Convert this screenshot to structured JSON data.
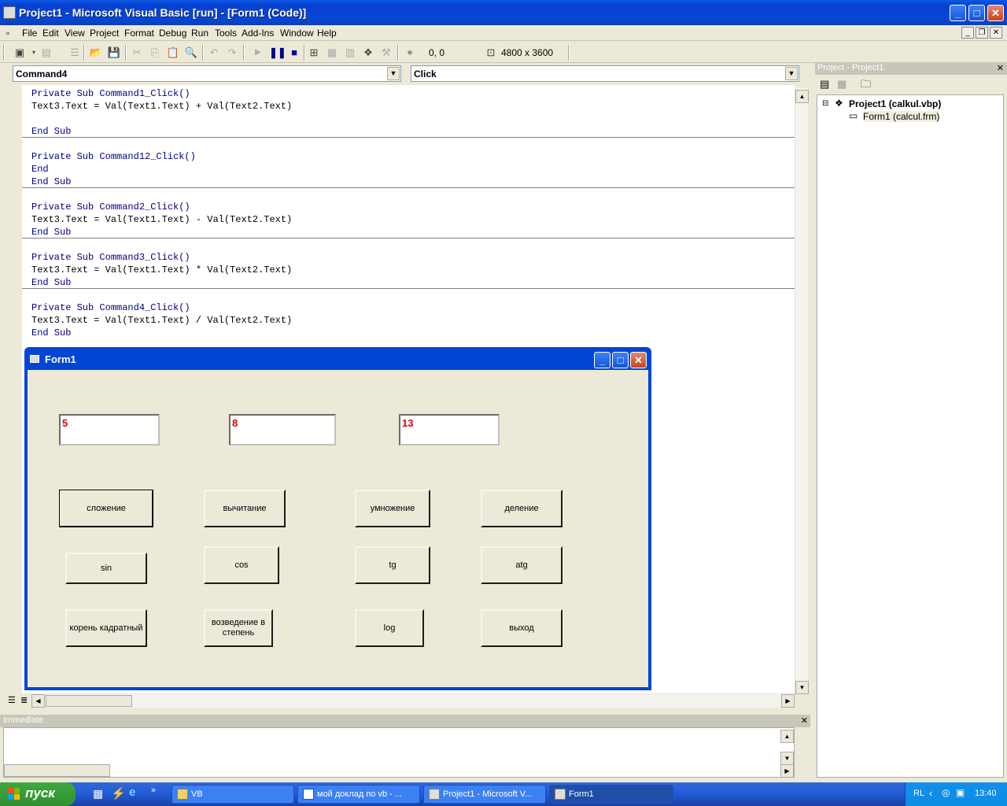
{
  "window": {
    "title": "Project1 - Microsoft Visual Basic [run] - [Form1 (Code)]"
  },
  "menu": [
    "File",
    "Edit",
    "View",
    "Project",
    "Format",
    "Debug",
    "Run",
    "Tools",
    "Add-Ins",
    "Window",
    "Help"
  ],
  "toolbar": {
    "position": "0, 0",
    "size": "4800 x 3600"
  },
  "code_window": {
    "object_combo": "Command4",
    "procedure_combo": "Click",
    "procedures": [
      {
        "header": "Private Sub Command1_Click()",
        "body": "Text3.Text = Val(Text1.Text) + Val(Text2.Text)\n",
        "end": "End Sub"
      },
      {
        "header": "Private Sub Command12_Click()",
        "body": "End",
        "end": "End Sub"
      },
      {
        "header": "Private Sub Command2_Click()",
        "body": "Text3.Text = Val(Text1.Text) - Val(Text2.Text)",
        "end": "End Sub"
      },
      {
        "header": "Private Sub Command3_Click()",
        "body": "Text3.Text = Val(Text1.Text) * Val(Text2.Text)",
        "end": "End Sub"
      },
      {
        "header": "Private Sub Command4_Click()",
        "body": "Text3.Text = Val(Text1.Text) / Val(Text2.Text)",
        "end": "End Sub"
      }
    ]
  },
  "immediate": {
    "title": "Immediate"
  },
  "project_explorer": {
    "title": "Project - Project1",
    "project": "Project1 (calkul.vbp)",
    "form": "Form1 (calcul.frm)"
  },
  "form1": {
    "title": "Form1",
    "text1": "5",
    "text2": "8",
    "text3": "13",
    "buttons": {
      "add": "сложение",
      "sub": "вычитание",
      "mul": "умножение",
      "div": "деление",
      "sin": "sin",
      "cos": "cos",
      "tg": "tg",
      "atg": "atg",
      "sqrt": "корень кадратный",
      "pow": "возведение в степень",
      "log": "log",
      "exit": "выход"
    }
  },
  "taskbar": {
    "start": "пуск",
    "tasks": [
      "VB",
      "мой доклад по vb - ...",
      "Project1 - Microsoft V...",
      "Form1"
    ],
    "lang": "RL",
    "time": "13:40"
  }
}
